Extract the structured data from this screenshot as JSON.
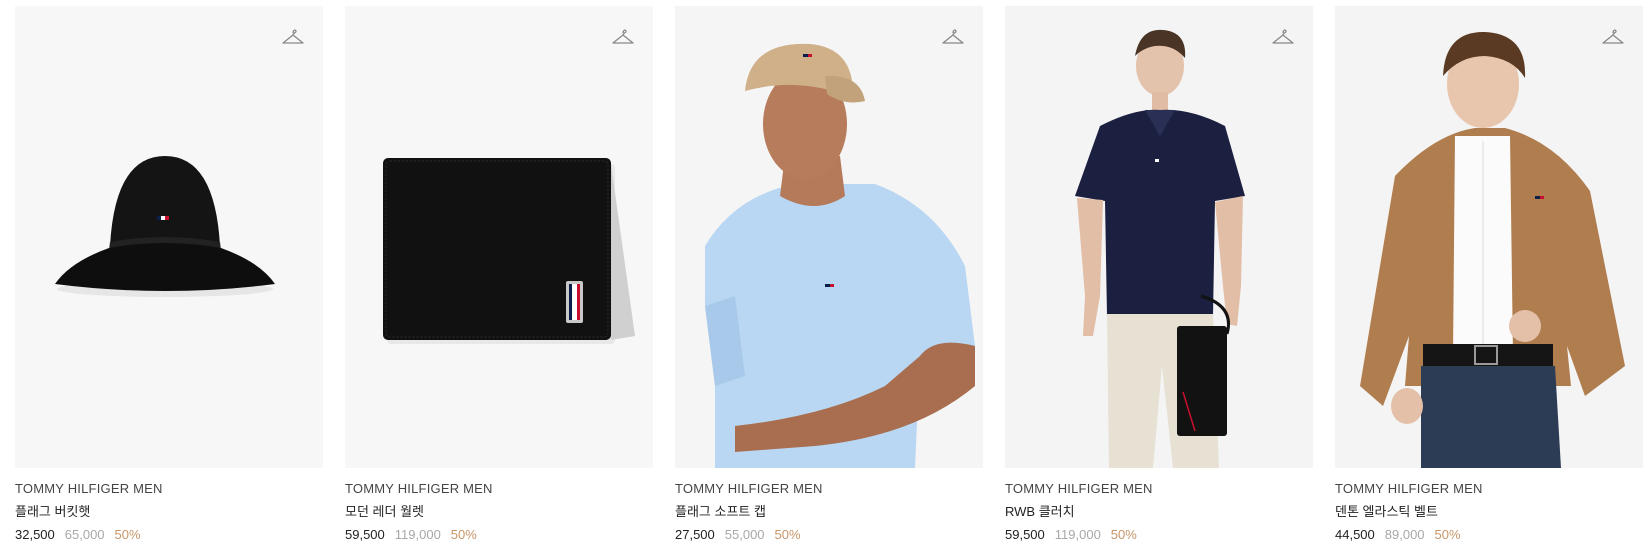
{
  "products": [
    {
      "brand": "TOMMY HILFIGER MEN",
      "name": "플래그 버킷햇",
      "price": "32,500",
      "original_price": "65,000",
      "discount": "50%",
      "image": "black bucket hat",
      "wishlist_icon": "hanger-icon"
    },
    {
      "brand": "TOMMY HILFIGER MEN",
      "name": "모던 레더 월렛",
      "price": "59,500",
      "original_price": "119,000",
      "discount": "50%",
      "image": "black leather bifold wallet",
      "wishlist_icon": "hanger-icon"
    },
    {
      "brand": "TOMMY HILFIGER MEN",
      "name": "플래그 소프트 캡",
      "price": "27,500",
      "original_price": "55,000",
      "discount": "50%",
      "image": "model in beige cap and light blue tee",
      "wishlist_icon": "hanger-icon"
    },
    {
      "brand": "TOMMY HILFIGER MEN",
      "name": "RWB 클러치",
      "price": "59,500",
      "original_price": "119,000",
      "discount": "50%",
      "image": "model with navy polo holding black clutch",
      "wishlist_icon": "hanger-icon"
    },
    {
      "brand": "TOMMY HILFIGER MEN",
      "name": "덴톤 엘라스틱 벨트",
      "price": "44,500",
      "original_price": "89,000",
      "discount": "50%",
      "image": "model in tan jacket and jeans with belt",
      "wishlist_icon": "hanger-icon"
    }
  ],
  "colors": {
    "image_bg": "#f6f6f6",
    "original_price": "#a8a8a8",
    "discount": "#c8956a"
  }
}
